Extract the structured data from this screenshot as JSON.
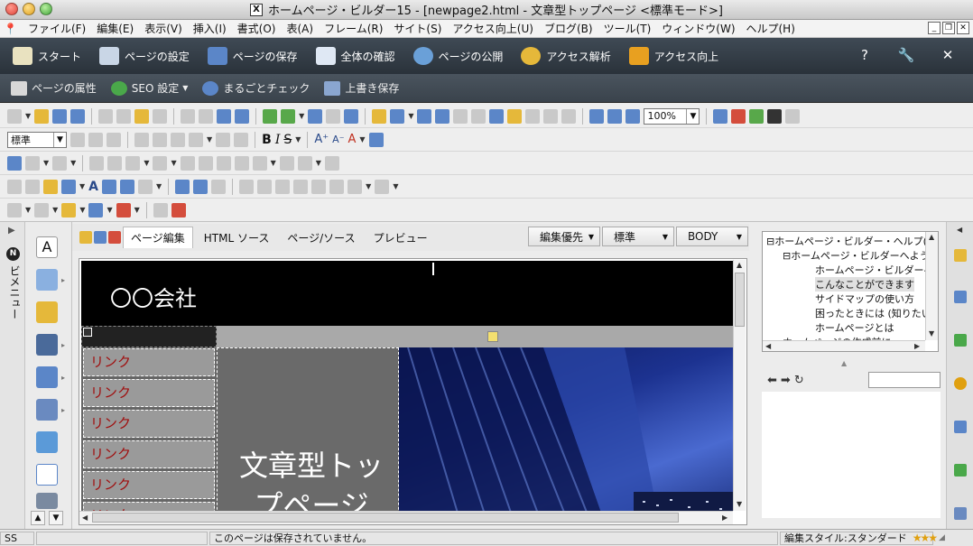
{
  "window": {
    "title": "ホームページ・ビルダー15 - [newpage2.html - 文章型トップページ <標準モード>]",
    "app_icon": "X"
  },
  "menu": {
    "items": [
      "ファイル(F)",
      "編集(E)",
      "表示(V)",
      "挿入(I)",
      "書式(O)",
      "表(A)",
      "フレーム(R)",
      "サイト(S)",
      "アクセス向上(U)",
      "ブログ(B)",
      "ツール(T)",
      "ウィンドウ(W)",
      "ヘルプ(H)"
    ]
  },
  "main_toolbar": {
    "buttons": [
      "スタート",
      "ページの設定",
      "ページの保存",
      "全体の確認",
      "ページの公開",
      "アクセス解析",
      "アクセス向上"
    ]
  },
  "sub_toolbar": {
    "buttons": [
      "ページの属性",
      "SEO 設定",
      "まるごとチェック",
      "上書き保存"
    ]
  },
  "format_toolbar": {
    "style_value": "標準",
    "zoom_value": "100%"
  },
  "left_panel": {
    "label": "ビメニュー"
  },
  "tabs": {
    "items": [
      "ページ編集",
      "HTML ソース",
      "ページ/ソース",
      "プレビュー"
    ],
    "combo1": "編集優先",
    "combo2": "標準",
    "combo3": "BODY"
  },
  "page": {
    "company": "〇〇会社",
    "links": [
      "リンク",
      "リンク",
      "リンク",
      "リンク",
      "リンク",
      "リンク"
    ],
    "center_text": "文章型トップページ"
  },
  "help_tree": {
    "items": [
      "ホームページ・ビルダー・ヘルプ(目",
      "ホームページ・ビルダーへようこ",
      "ホームページ・ビルダーへ",
      "こんなことができます",
      "サイドマップの使い方",
      "困ったときには (知りたい",
      "ホームページとは",
      "ホームページの作成前に"
    ]
  },
  "status": {
    "mode": "SS",
    "message": "このページは保存されていません。",
    "style": "編集スタイル:スタンダード",
    "stars": "★★★"
  },
  "colors": {
    "toolbar_bg": "#2f3840",
    "link_text": "#a01010",
    "page_header": "#000000"
  }
}
